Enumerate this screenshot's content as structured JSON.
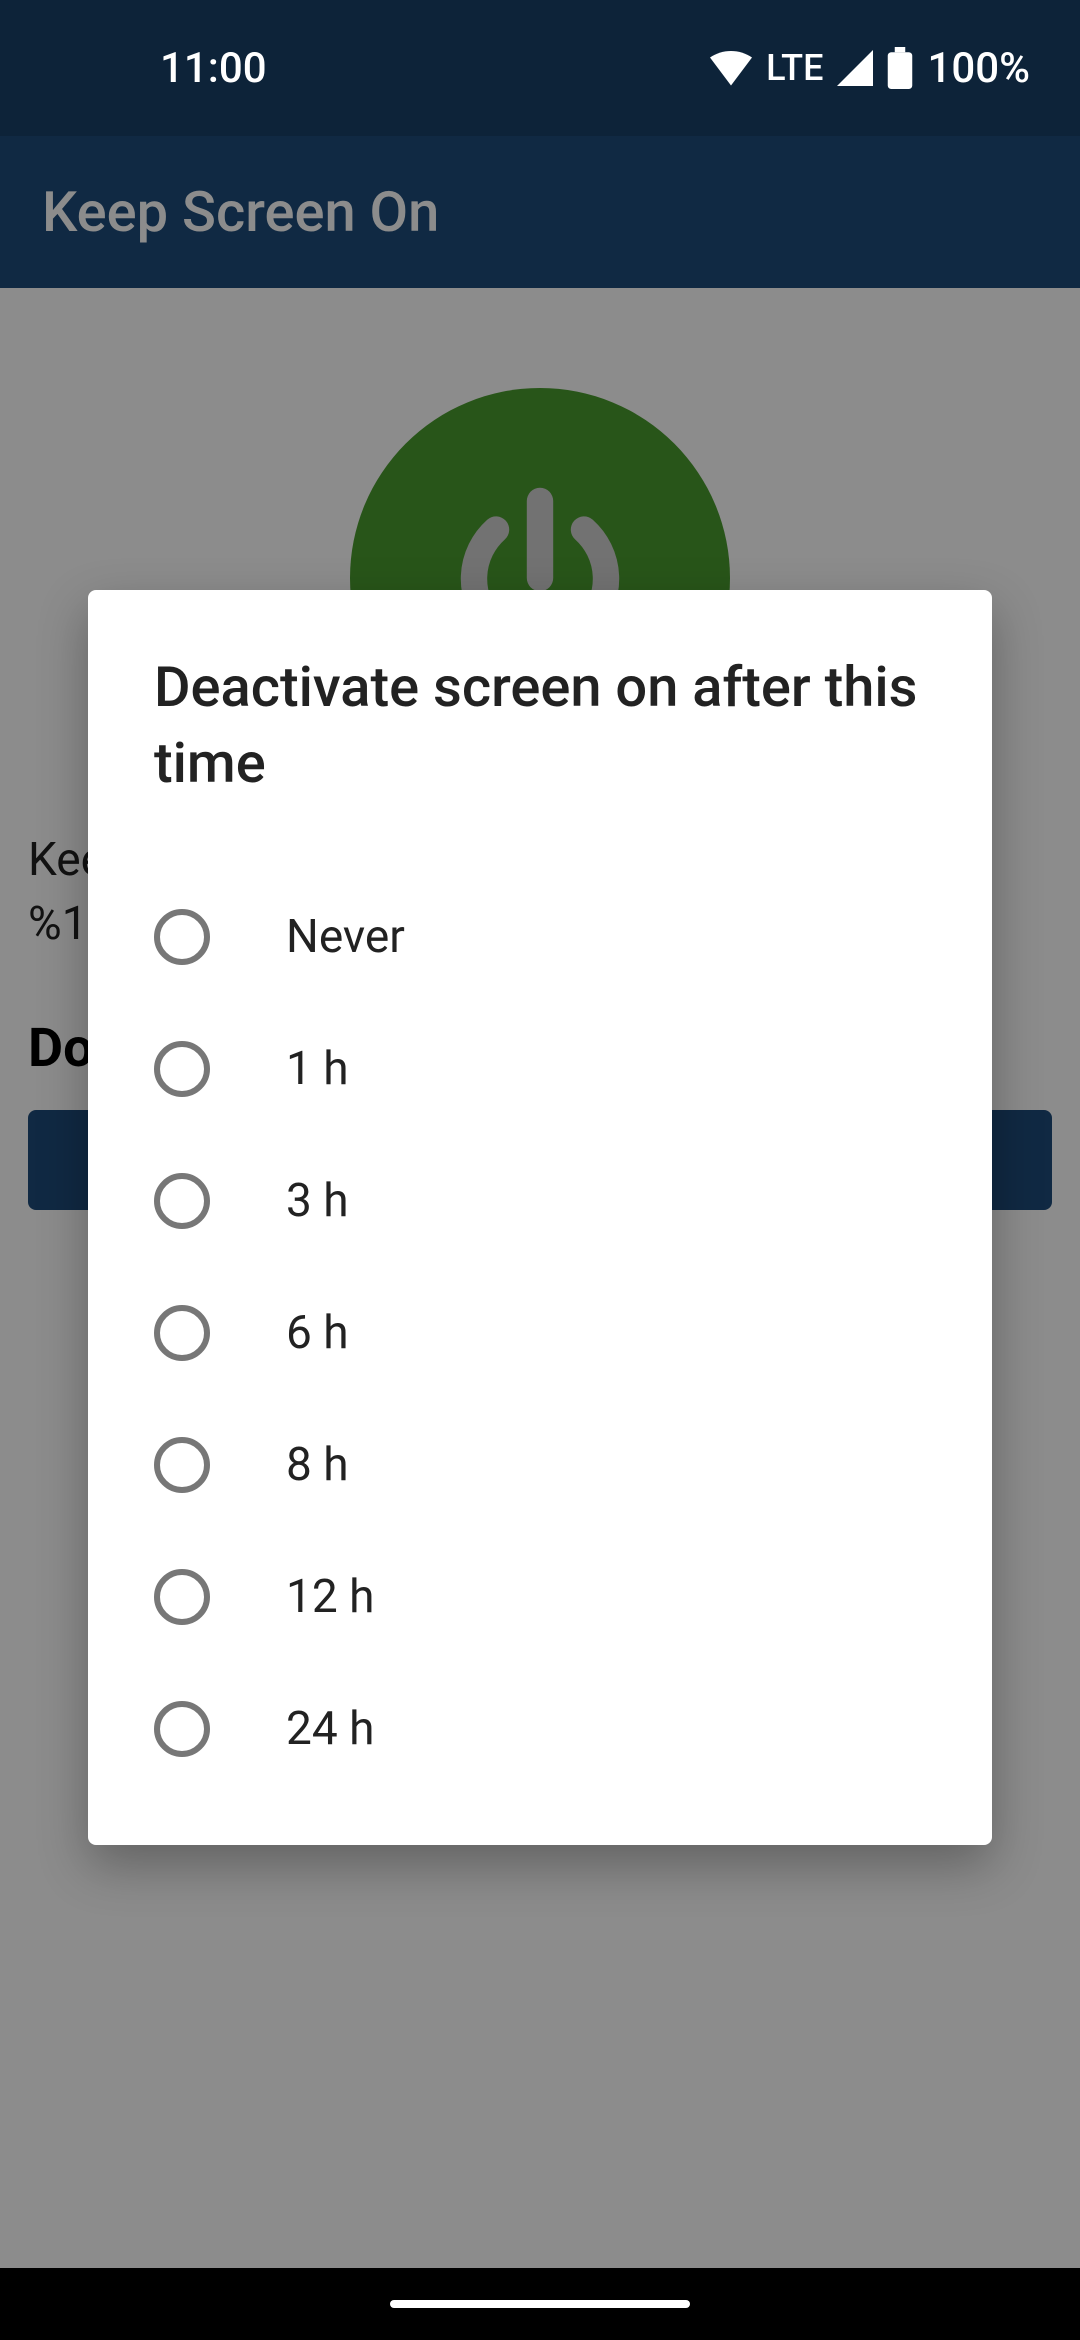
{
  "status": {
    "time": "11:00",
    "network": "LTE",
    "battery": "100%"
  },
  "app_bar": {
    "title": "Keep Screen On"
  },
  "main": {
    "description_line1": "Kee",
    "description_line2": "%1",
    "section_label": "Do",
    "donate_label": ""
  },
  "dialog": {
    "title": "Deactivate screen on after this time",
    "options": [
      {
        "label": "Never"
      },
      {
        "label": "1 h"
      },
      {
        "label": "3 h"
      },
      {
        "label": "6 h"
      },
      {
        "label": "8 h"
      },
      {
        "label": "12 h"
      },
      {
        "label": "24 h"
      }
    ]
  }
}
